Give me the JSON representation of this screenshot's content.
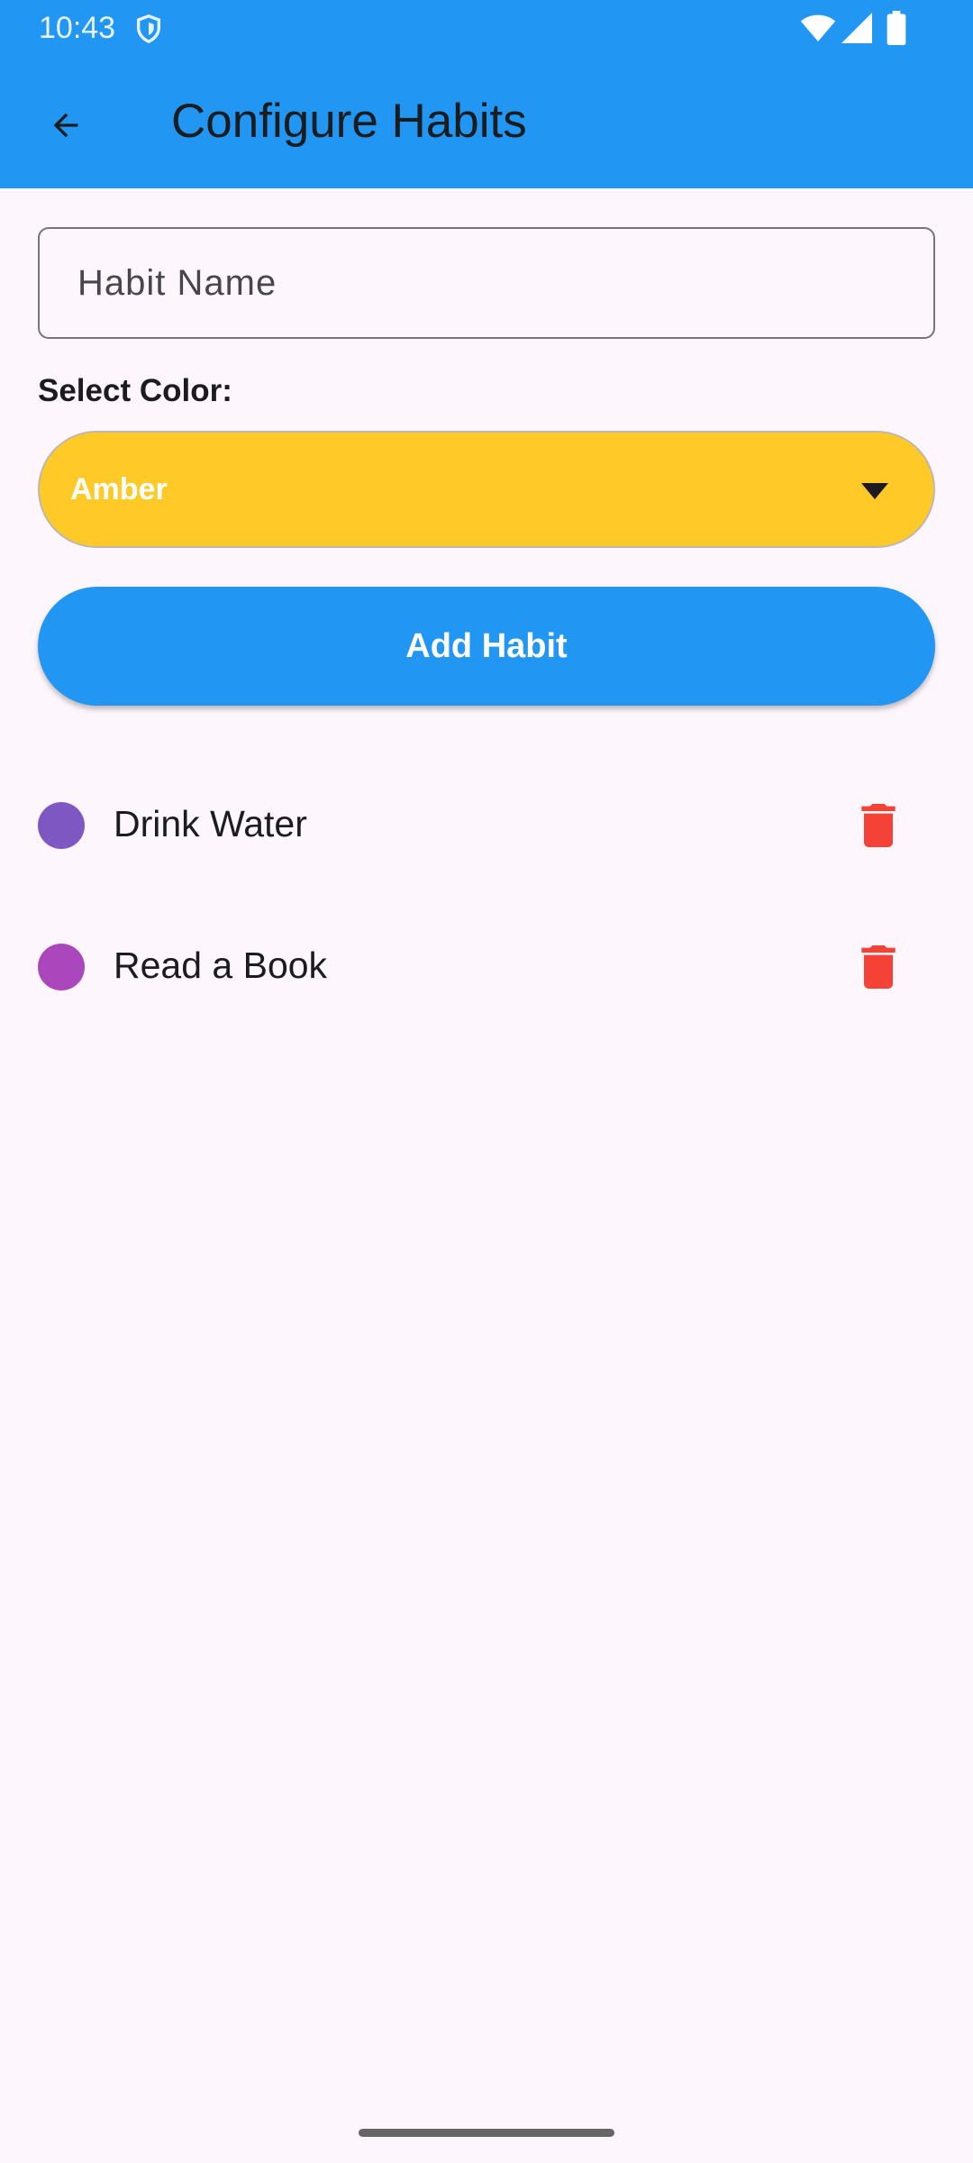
{
  "status_bar": {
    "time": "10:43"
  },
  "app_bar": {
    "title": "Configure Habits",
    "back_icon": "arrow-back-icon"
  },
  "form": {
    "habit_name_placeholder": "Habit Name",
    "select_color_label": "Select Color:",
    "selected_color": "Amber",
    "selected_color_hex": "#FFCA28",
    "add_button_label": "Add Habit"
  },
  "habits": [
    {
      "name": "Drink Water",
      "color": "#7E57C2"
    },
    {
      "name": "Read a Book",
      "color": "#AB47BC"
    }
  ],
  "colors": {
    "primary": "#2196F3",
    "delete": "#F44336",
    "background": "#FDF6FC"
  }
}
